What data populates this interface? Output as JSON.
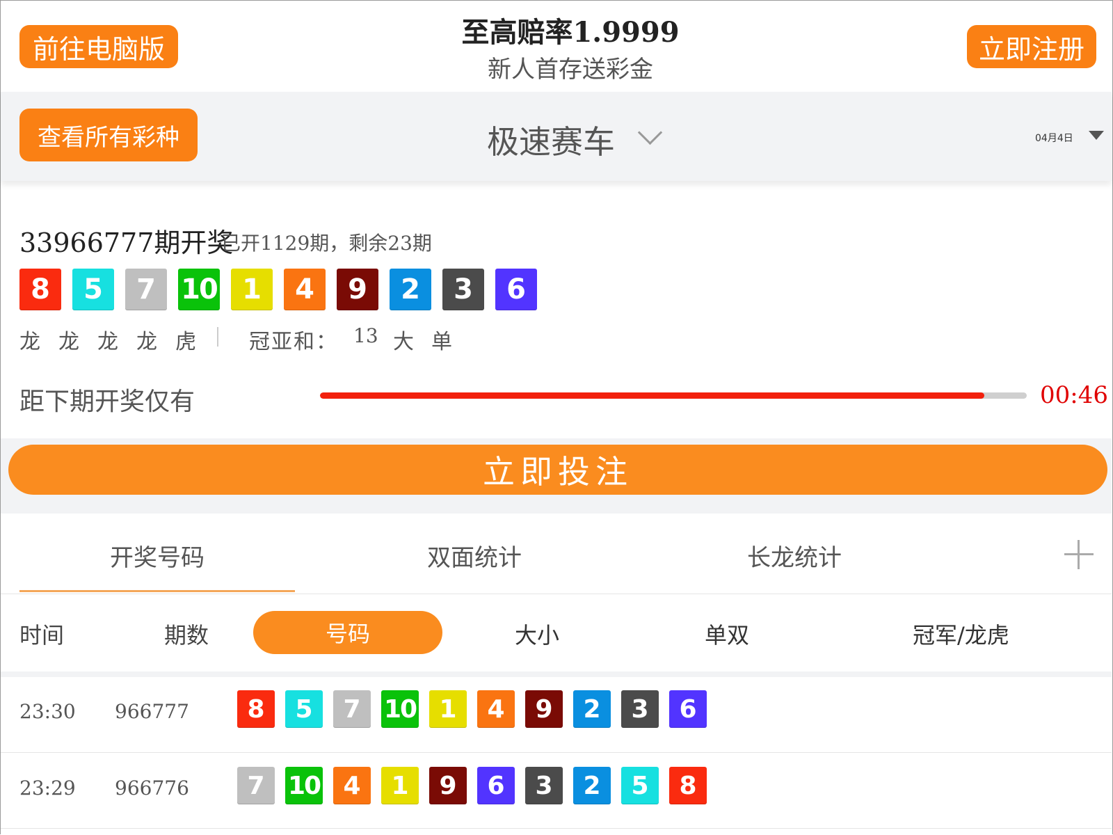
{
  "header": {
    "pc_button": "前往电脑版",
    "title": "至高赔率1.9999",
    "subtitle": "新人首存送彩金",
    "register_button": "立即注册"
  },
  "selector": {
    "all_lotteries_button": "查看所有彩种",
    "lottery_name": "极速赛车",
    "date": "04月4日"
  },
  "draw": {
    "issue_text": "33966777期开奖",
    "status_text": "已开1129期，剩余23期",
    "numbers": [
      "8",
      "5",
      "7",
      "10",
      "1",
      "4",
      "9",
      "2",
      "3",
      "6"
    ],
    "dragon_tiger": [
      "龙",
      "龙",
      "龙",
      "龙",
      "虎"
    ],
    "sum_label": "冠亚和：",
    "sum_value": "13",
    "sum_size": "大",
    "sum_odd_even": "单"
  },
  "countdown": {
    "label": "距下期开奖仅有",
    "time": "00:46",
    "progress": 0.94
  },
  "bet_button": "立即投注",
  "tabs": [
    "开奖号码",
    "双面统计",
    "长龙统计"
  ],
  "active_tab": 0,
  "sub_tabs": {
    "time": "时间",
    "issue": "期数",
    "number": "号码",
    "size": "大小",
    "odd_even": "单双",
    "champion": "冠军/龙虎"
  },
  "history": [
    {
      "time": "23:30",
      "issue": "966777",
      "numbers": [
        "8",
        "5",
        "7",
        "10",
        "1",
        "4",
        "9",
        "2",
        "3",
        "6"
      ]
    },
    {
      "time": "23:29",
      "issue": "966776",
      "numbers": [
        "7",
        "10",
        "4",
        "1",
        "9",
        "6",
        "3",
        "2",
        "5",
        "8"
      ]
    }
  ],
  "ball_colors": {
    "1": "#e6de00",
    "2": "#0a8fe0",
    "3": "#4b4b4b",
    "4": "#fa7411",
    "5": "#17e0e0",
    "6": "#5234ff",
    "7": "#bfbfbf",
    "8": "#fa2b0f",
    "9": "#7a0b05",
    "10": "#0ac20a"
  }
}
